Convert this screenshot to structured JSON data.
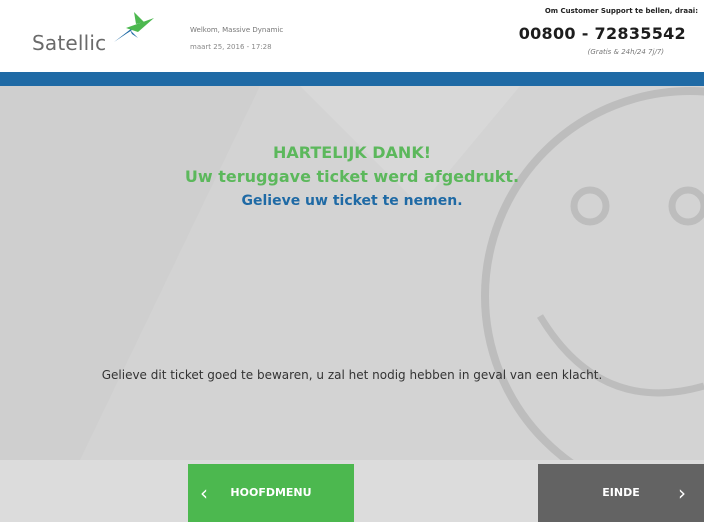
{
  "header": {
    "brand": "Satellic",
    "welcome": "Welkom, Massive Dynamic",
    "datetime": "maart 25, 2016 - 17:28",
    "support_label": "Om Customer Support te bellen, draai:",
    "support_number": "00800 - 72835542",
    "support_note": "(Gratis & 24h/24 7j/7)"
  },
  "main": {
    "title_line1": "HARTELIJK DANK!",
    "title_line2": "Uw teruggave ticket werd afgedrukt.",
    "instruction": "Gelieve uw ticket te nemen.",
    "note": "Gelieve dit ticket goed te bewaren, u zal het nodig hebben in geval van een klacht."
  },
  "footer": {
    "menu_label": "HOOFDMENU",
    "end_label": "EINDE"
  },
  "colors": {
    "accent_blue": "#1f6aa5",
    "success_green": "#5cb85c",
    "button_green": "#4cb84f",
    "button_gray": "#636363"
  },
  "icons": {
    "brand_mark": "satellic-bird-icon",
    "background": "smiley-face-icon",
    "menu_chevron": "chevron-left-icon",
    "end_chevron": "chevron-right-icon"
  }
}
